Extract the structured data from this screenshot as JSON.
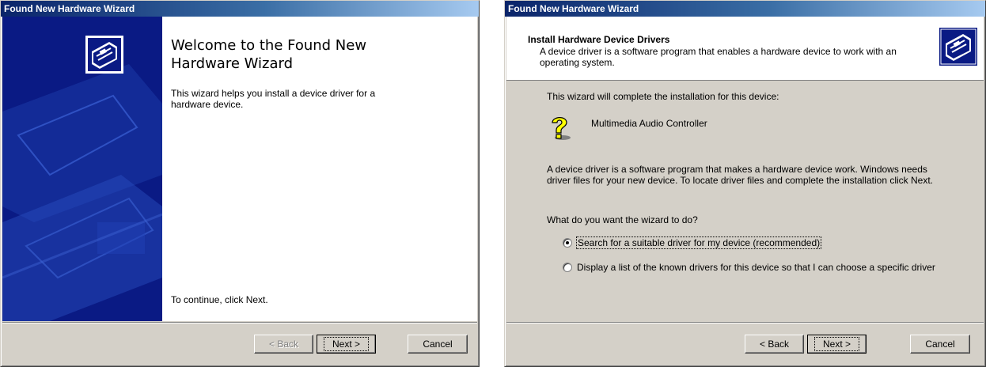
{
  "wizard1": {
    "title": "Found New Hardware Wizard",
    "heading": "Welcome to the Found New Hardware Wizard",
    "intro": "This wizard helps you install a device driver for a hardware device.",
    "continue_text": "To continue, click Next.",
    "buttons": {
      "back": "< Back",
      "next": "Next >",
      "cancel": "Cancel"
    }
  },
  "wizard2": {
    "title": "Found New Hardware Wizard",
    "header_title": "Install Hardware Device Drivers",
    "header_subtitle": "A device driver is a software program that enables a hardware device to work with an operating system.",
    "completion_text": "This wizard will complete the installation for this device:",
    "device_name": "Multimedia Audio Controller",
    "description": "A device driver is a software program that makes a hardware device work. Windows needs driver files for your new device. To locate driver files and complete the installation click Next.",
    "question": "What do you want the wizard to do?",
    "options": [
      {
        "label": "Search for a suitable driver for my device (recommended)",
        "selected": true
      },
      {
        "label": "Display a list of the known drivers for this device so that I can choose a specific driver",
        "selected": false
      }
    ],
    "buttons": {
      "back": "< Back",
      "next": "Next >",
      "cancel": "Cancel"
    }
  },
  "icons": {
    "hardware": "hardware-chip-icon",
    "unknown_device": "question-mark-icon"
  },
  "colors": {
    "titlebar_start": "#0a246a",
    "titlebar_end": "#a6caf0",
    "banner": "#0a1a84",
    "dialog_face": "#d4d0c8"
  }
}
